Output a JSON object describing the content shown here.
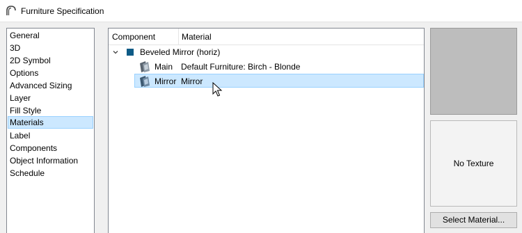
{
  "window": {
    "title": "Furniture Specification"
  },
  "nav": {
    "items": [
      "General",
      "3D",
      "2D Symbol",
      "Options",
      "Advanced Sizing",
      "Layer",
      "Fill Style",
      "Materials",
      "Label",
      "Components",
      "Object Information",
      "Schedule"
    ],
    "selected": "Materials"
  },
  "tree": {
    "columns": [
      "Component",
      "Material"
    ],
    "group": {
      "name": "Beveled Mirror (horiz)",
      "expanded": true,
      "swatch_color": "#0e5b86"
    },
    "rows": [
      {
        "component": "Main",
        "material": "Default Furniture: Birch - Blonde",
        "icon": "material-icon"
      },
      {
        "component": "Mirror",
        "material": "Mirror",
        "icon": "material-icon",
        "selected": true
      }
    ]
  },
  "preview": {
    "no_texture_label": "No Texture"
  },
  "buttons": {
    "select_material": "Select Material..."
  },
  "colors": {
    "selection_fill": "#cce8ff",
    "selection_border": "#99d1ff",
    "preview_gray": "#bdbdbd"
  }
}
